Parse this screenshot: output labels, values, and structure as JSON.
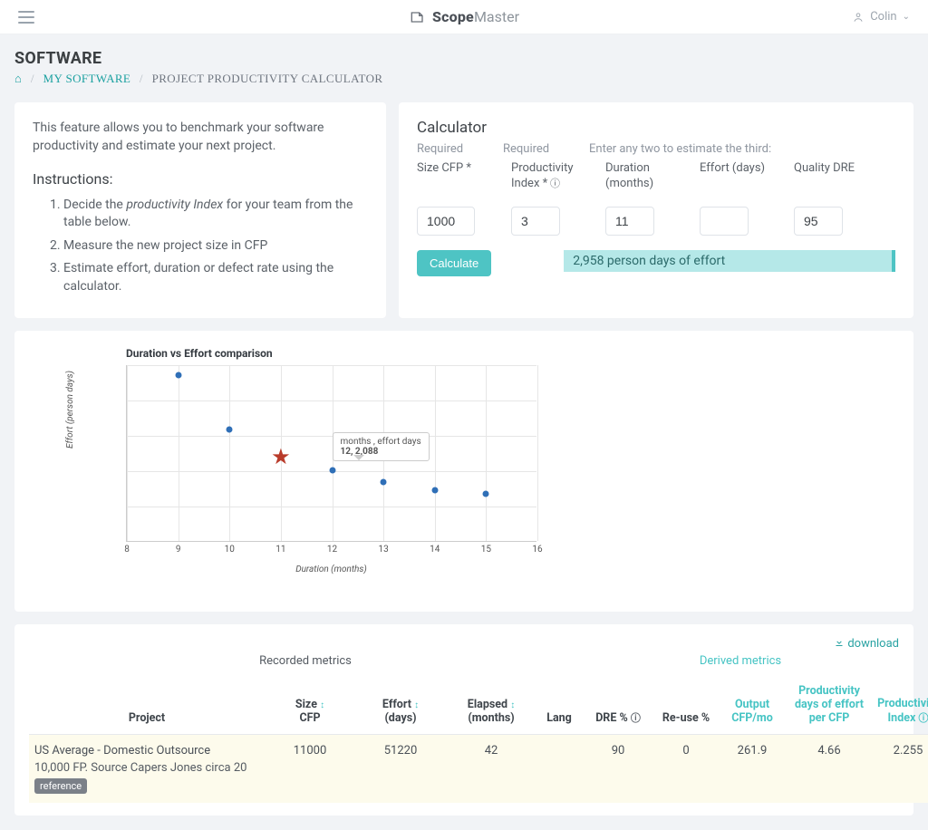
{
  "brand": {
    "name_bold": "Scope",
    "name_light": "Master"
  },
  "user": {
    "name": "Colin"
  },
  "page": {
    "title": "SOFTWARE",
    "breadcrumb": {
      "my_software": "MY SOFTWARE",
      "current": "PROJECT PRODUCTIVITY CALCULATOR"
    }
  },
  "intro": {
    "blurb": "This feature allows you to benchmark your software productivity and estimate your next project.",
    "instructions_heading": "Instructions:",
    "steps": [
      "Decide the productivity Index for your team from the table below.",
      "Measure the new project size in CFP",
      "Estimate effort, duration or defect rate using the calculator."
    ]
  },
  "calc": {
    "title": "Calculator",
    "hint_required1": "Required",
    "hint_required2": "Required",
    "hint_any_two": "Enter any two to estimate the third:",
    "fields": {
      "size": {
        "label": "Size CFP *",
        "value": "1000"
      },
      "pi": {
        "label": "Productivity Index *",
        "value": "3"
      },
      "duration": {
        "label": "Duration (months)",
        "value": "11"
      },
      "effort": {
        "label": "Effort (days)",
        "value": ""
      },
      "quality": {
        "label": "Quality DRE",
        "value": "95"
      }
    },
    "button": "Calculate",
    "result": "2,958 person days of effort"
  },
  "chart_data": {
    "type": "scatter",
    "title": "Duration vs Effort comparison",
    "xlabel": "Duration (months)",
    "ylabel": "Effort (person days)",
    "xlim": [
      8,
      16
    ],
    "ylim": [
      0,
      5200
    ],
    "xticks": [
      8,
      9,
      10,
      11,
      12,
      13,
      14,
      15,
      16
    ],
    "series": [
      {
        "name": "projects",
        "marker": "dot",
        "points": [
          [
            9,
            4900
          ],
          [
            10,
            3300
          ],
          [
            12,
            2100
          ],
          [
            13,
            1750
          ],
          [
            14,
            1500
          ],
          [
            15,
            1400
          ]
        ]
      },
      {
        "name": "selected",
        "marker": "star",
        "points": [
          [
            11,
            2500
          ]
        ]
      }
    ],
    "tooltip": {
      "header": "months , effort days",
      "value": "12, 2,088",
      "at": [
        12,
        2100
      ]
    }
  },
  "table": {
    "download": "download",
    "group_recorded": "Recorded metrics",
    "group_derived": "Derived metrics",
    "cols": {
      "project": "Project",
      "size": "Size",
      "size_sub": "CFP",
      "effort": "Effort",
      "effort_sub": "(days)",
      "elapsed": "Elapsed",
      "elapsed_sub": "(months)",
      "lang": "Lang",
      "dre": "DRE %",
      "reuse": "Re-use %",
      "output": "Output",
      "output_sub": "CFP/mo",
      "pdpcfp": "Productivity days of effort per CFP",
      "pi": "Productivity Index"
    },
    "rows": [
      {
        "name": "US Average - Domestic Outsource",
        "sub": "10,000 FP. Source Capers Jones circa 20",
        "badge": "reference",
        "size": "11000",
        "effort": "51220",
        "elapsed": "42",
        "lang": "",
        "dre": "90",
        "reuse": "0",
        "output": "261.9",
        "pdpcfp": "4.66",
        "pi": "2.255"
      }
    ]
  }
}
